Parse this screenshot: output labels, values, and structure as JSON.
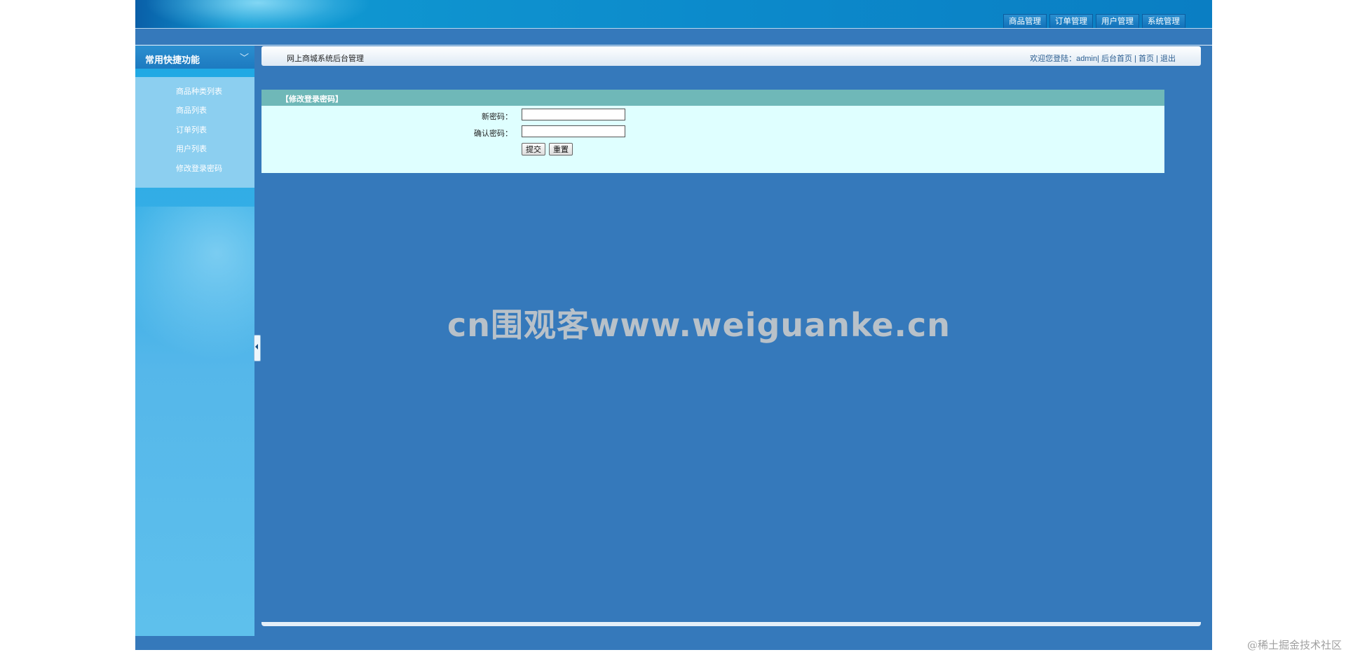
{
  "header": {
    "nav": [
      "商品管理",
      "订单管理",
      "用户管理",
      "系统管理"
    ]
  },
  "sidebar": {
    "title": "常用快捷功能",
    "items": [
      {
        "label": "商品种类列表"
      },
      {
        "label": "商品列表"
      },
      {
        "label": "订单列表"
      },
      {
        "label": "用户列表"
      },
      {
        "label": "修改登录密码"
      }
    ]
  },
  "breadcrumb": {
    "title": "网上商城系统后台管理",
    "welcome": "欢迎您登陆：",
    "user": "admin",
    "links": [
      "后台首页",
      "首页",
      "退出"
    ]
  },
  "form": {
    "title": "【修改登录密码】",
    "new_password_label": "新密码：",
    "confirm_password_label": "确认密码：",
    "new_password_value": "",
    "confirm_password_value": "",
    "submit_label": "提交",
    "reset_label": "重置"
  },
  "watermark": "cn围观客www.weiguanke.cn",
  "footer_credit": "@稀土掘金技术社区"
}
